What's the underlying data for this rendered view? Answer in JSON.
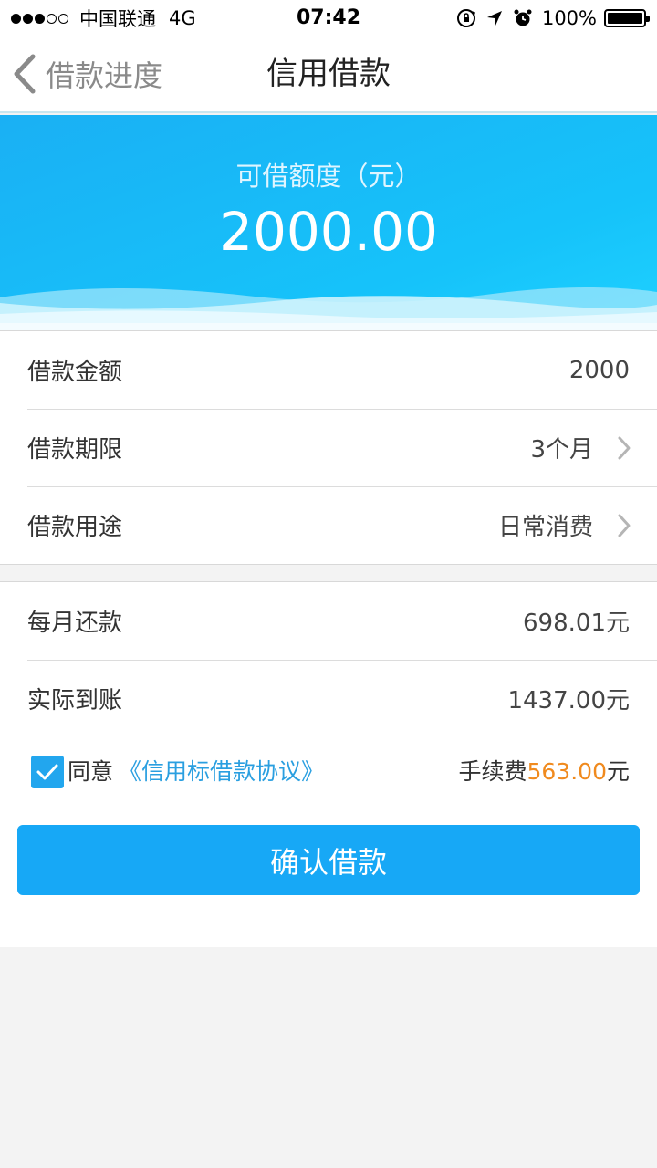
{
  "status_bar": {
    "signal_dots_filled": 3,
    "signal_dots_total": 5,
    "carrier": "中国联通",
    "network": "4G",
    "time": "07:42",
    "battery": "100%",
    "battery_level": 1.0,
    "icons": [
      "rotation-lock-icon",
      "location-arrow-icon",
      "alarm-clock-icon",
      "battery-icon"
    ]
  },
  "nav": {
    "back_label": "借款进度",
    "title": "信用借款"
  },
  "hero": {
    "label": "可借额度（元）",
    "amount": "2000.00"
  },
  "loan_details": [
    {
      "label": "借款金额",
      "value": "2000",
      "has_chevron": false
    },
    {
      "label": "借款期限",
      "value": "3个月",
      "has_chevron": true
    },
    {
      "label": "借款用途",
      "value": "日常消费",
      "has_chevron": true
    }
  ],
  "repayment": [
    {
      "label": "每月还款",
      "value": "698.01元"
    },
    {
      "label": "实际到账",
      "value": "1437.00元"
    }
  ],
  "agreement": {
    "checked": true,
    "agree_label": "同意",
    "link_text": "《信用标借款协议》",
    "fee_label": "手续费",
    "fee_amount": "563.00",
    "fee_unit": "元"
  },
  "confirm_button": "确认借款",
  "colors": {
    "accent": "#17a8f6",
    "link": "#2a9fe0",
    "fee_highlight": "#f08a1e",
    "hero_gradient_start": "#1ab0f4",
    "hero_gradient_end": "#1fd1ff",
    "background": "#f3f3f3"
  }
}
